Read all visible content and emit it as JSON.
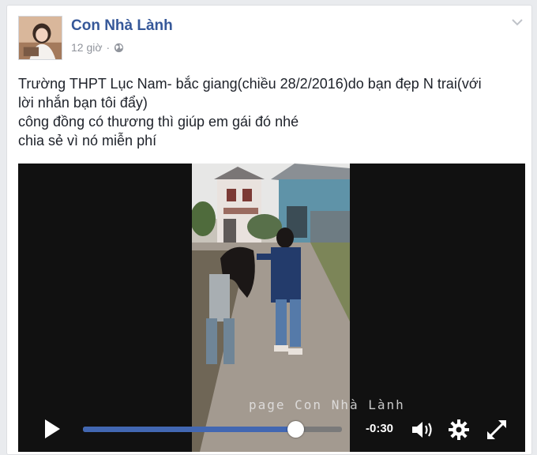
{
  "post": {
    "author": "Con Nhà Lành",
    "time": "12 giờ",
    "separator": "·",
    "privacy_icon": "globe-icon",
    "menu_icon": "chevron-down-icon",
    "text_lines": [
      "Trường THPT Lục Nam- bắc giang(chiều 28/2/2016)do bạn đẹp N trai(với",
      "lời nhắn bạn tôi đẩy)",
      "công đồng có thương thì giúp em gái đó nhé",
      "chia sẻ vì nó miễn phí"
    ]
  },
  "video": {
    "watermark": "page Con Nhà Lành",
    "time_remaining": "-0:30",
    "progress": 0.82,
    "icons": {
      "play": "play-icon",
      "volume": "volume-icon",
      "settings": "gear-icon",
      "fullscreen": "fullscreen-icon"
    }
  },
  "colors": {
    "author_link": "#365899",
    "progress_fill": "#4267b2",
    "meta_text": "#90949c"
  }
}
